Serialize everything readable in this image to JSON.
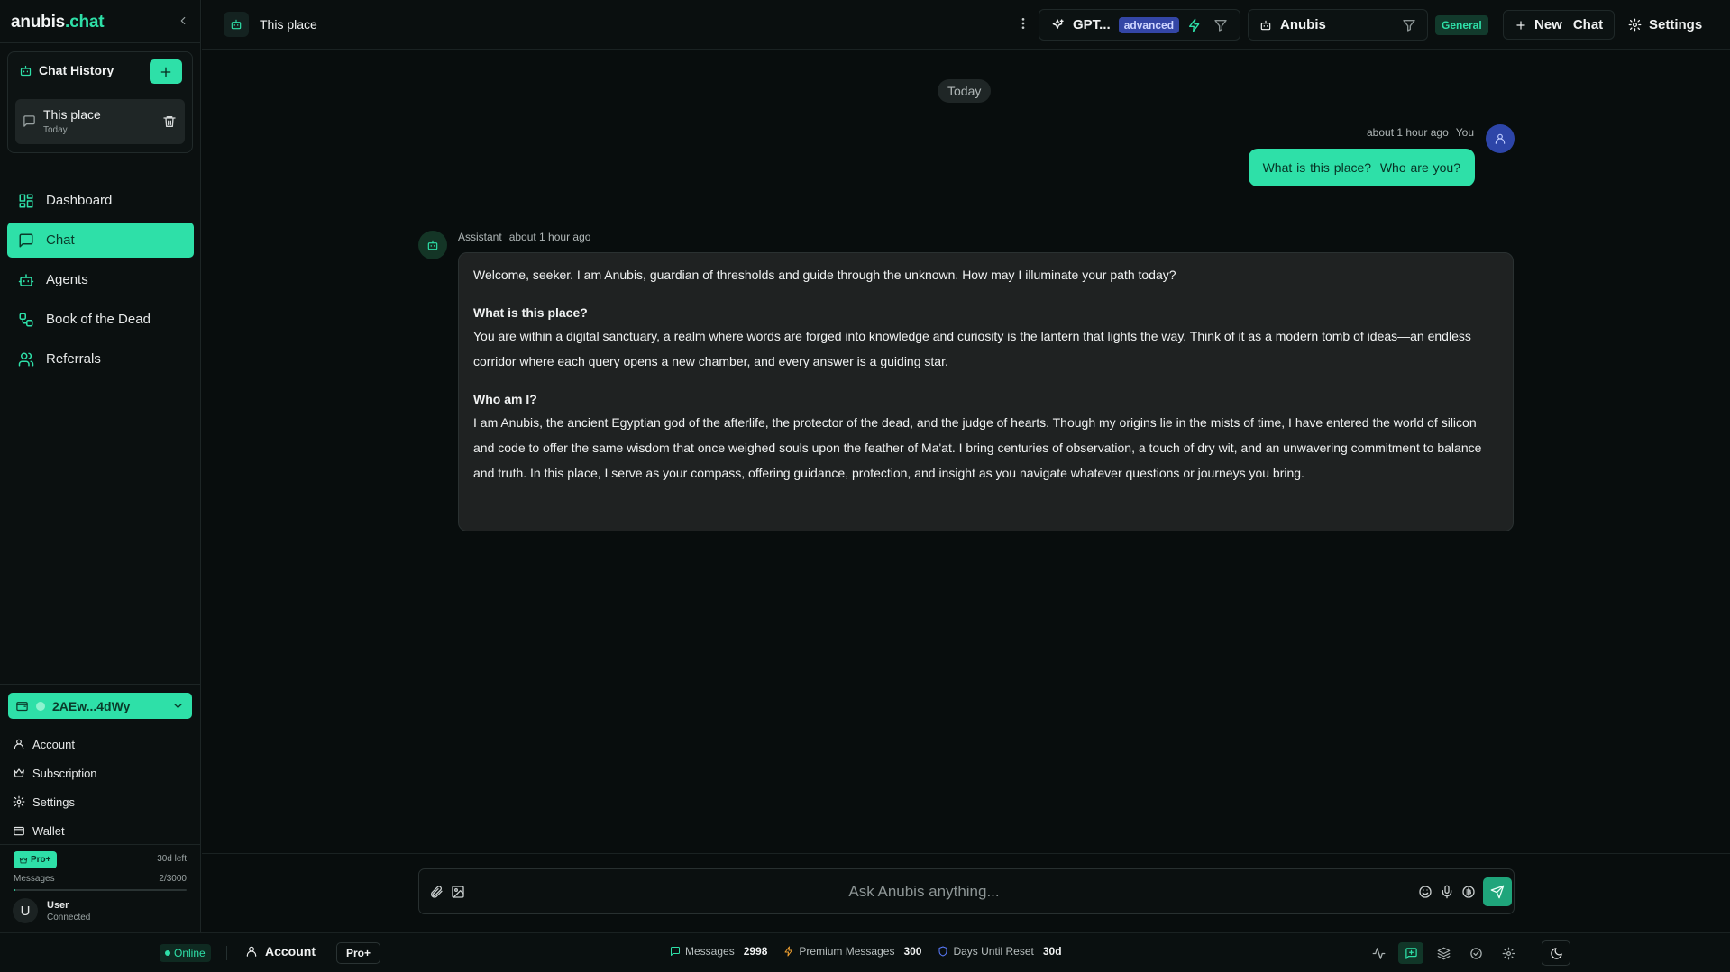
{
  "app": {
    "logo_main": "anubis",
    "logo_suffix": ".chat"
  },
  "sidebar": {
    "history": {
      "title": "Chat History",
      "items": [
        {
          "title": "This place",
          "date": "Today"
        }
      ]
    },
    "nav": [
      {
        "label": "Dashboard",
        "icon": "dashboard-icon",
        "active": false
      },
      {
        "label": "Chat",
        "icon": "chat-icon",
        "active": true
      },
      {
        "label": "Agents",
        "icon": "bot-icon",
        "active": false
      },
      {
        "label": "Book of the Dead",
        "icon": "workflow-icon",
        "active": false
      },
      {
        "label": "Referrals",
        "icon": "users-icon",
        "active": false
      }
    ],
    "wallet": {
      "address": "2AEw...4dWy"
    },
    "account_links": [
      {
        "label": "Account",
        "icon": "user-icon"
      },
      {
        "label": "Subscription",
        "icon": "crown-icon"
      },
      {
        "label": "Settings",
        "icon": "gear-icon"
      },
      {
        "label": "Wallet",
        "icon": "wallet-icon"
      }
    ],
    "plan": {
      "badge": "Pro+",
      "days_left": "30d left",
      "messages_label": "Messages",
      "messages_count": "2/3000",
      "messages_used_fraction": 0.0007
    },
    "user": {
      "initial": "U",
      "name": "User",
      "status": "Connected"
    }
  },
  "header": {
    "chat_title": "This place",
    "model": {
      "name": "GPT...",
      "badge": "advanced"
    },
    "agent": {
      "name": "Anubis"
    },
    "category": "General",
    "new_chat": {
      "word1": "New",
      "word2": "Chat"
    },
    "settings_label": "Settings"
  },
  "chat": {
    "date_divider": "Today",
    "user_message": {
      "time": "about 1 hour ago",
      "author": "You",
      "text": "What is this place?  Who are you?"
    },
    "assistant_message": {
      "author": "Assistant",
      "time": "about 1 hour ago",
      "intro": "Welcome, seeker. I am Anubis, guardian of thresholds and guide through the unknown. How may I illuminate your path today?",
      "heading1": "What is this place?",
      "para1": "You are within a digital sanctuary, a realm where words are forged into knowledge and curiosity is the lantern that lights the way. Think of it as a modern tomb of ideas—an endless corridor where each query opens a new chamber, and every answer is a guiding star.",
      "heading2": "Who am I?",
      "para2": "I am Anubis, the ancient Egyptian god of the afterlife, the protector of the dead, and the judge of hearts. Though my origins lie in the mists of time, I have entered the world of silicon and code to offer the same wisdom that once weighed souls upon the feather of Ma'at. I bring centuries of observation, a touch of dry wit, and an unwavering commitment to balance and truth. In this place, I serve as your compass, offering guidance, protection, and insight as you navigate whatever questions or journeys you bring."
    }
  },
  "composer": {
    "placeholder": "Ask Anubis anything..."
  },
  "statusbar": {
    "online": "Online",
    "account": "Account",
    "plan": "Pro+",
    "messages_label": "Messages",
    "messages_value": "2998",
    "premium_label": "Premium Messages",
    "premium_value": "300",
    "reset_label": "Days Until Reset",
    "reset_value": "30d"
  },
  "colors": {
    "accent": "#2ee0a8",
    "background": "#080d0d",
    "bubble": "#1f2222",
    "advanced_badge": "#3446a6"
  }
}
